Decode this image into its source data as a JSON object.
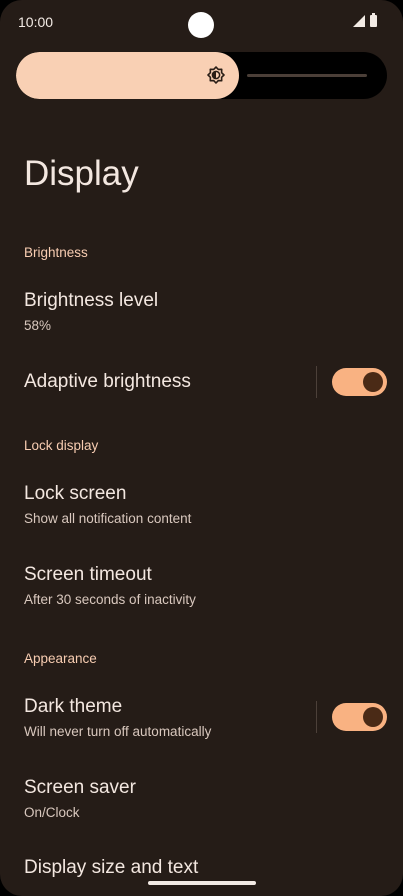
{
  "status_bar": {
    "time": "10:00",
    "icons": [
      "signal-icon",
      "battery-icon"
    ]
  },
  "brightness_slider": {
    "level_fraction": 0.6,
    "icon": "brightness-icon"
  },
  "page": {
    "title": "Display"
  },
  "sections": {
    "brightness": {
      "header": "Brightness",
      "level_title": "Brightness level",
      "level_value": "58%",
      "adaptive_title": "Adaptive brightness",
      "adaptive_on": true
    },
    "lock_display": {
      "header": "Lock display",
      "lock_screen_title": "Lock screen",
      "lock_screen_sub": "Show all notification content",
      "timeout_title": "Screen timeout",
      "timeout_sub": "After 30 seconds of inactivity"
    },
    "appearance": {
      "header": "Appearance",
      "dark_theme_title": "Dark theme",
      "dark_theme_sub": "Will never turn off automatically",
      "dark_theme_on": true,
      "screen_saver_title": "Screen saver",
      "screen_saver_sub": "On/Clock",
      "display_size_title": "Display size and text"
    }
  },
  "colors": {
    "background": "#251c17",
    "accent": "#f9b282",
    "slider_fill": "#f9d0b4",
    "section_header": "#f8cdb2"
  }
}
